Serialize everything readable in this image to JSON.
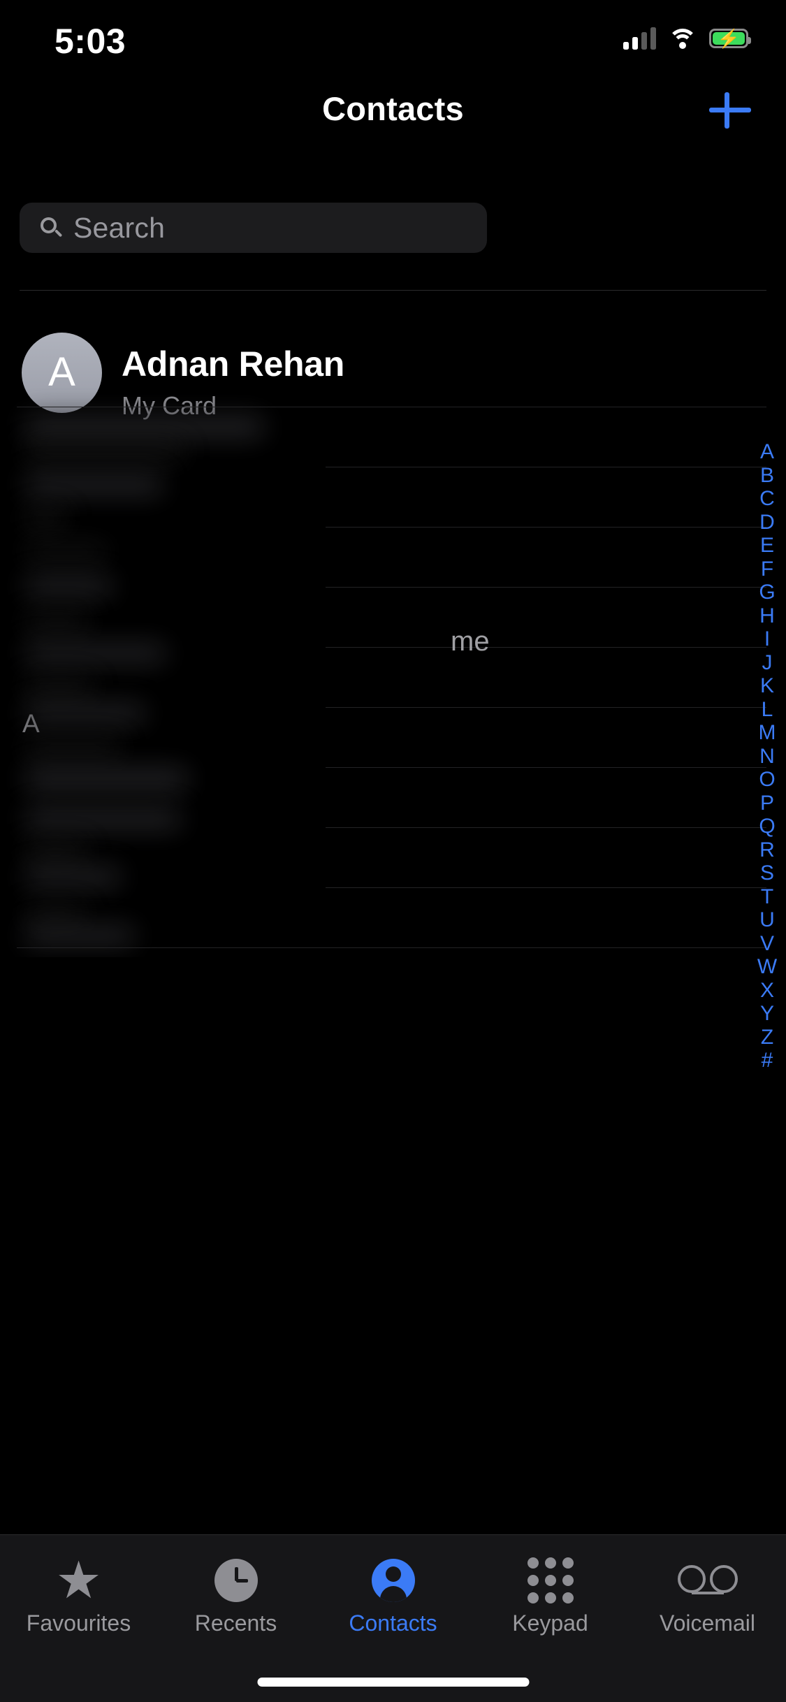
{
  "status_bar": {
    "time": "5:03",
    "signal_icon": "cellular-signal-icon",
    "wifi_icon": "wifi-icon",
    "battery_icon": "battery-charging-icon",
    "battery_charging": true,
    "battery_color": "#3ddc5c"
  },
  "nav": {
    "title": "Contacts",
    "add_button_icon": "plus-icon",
    "accent_color": "#3b7bf6"
  },
  "search": {
    "placeholder": "Search",
    "value": "",
    "icon": "search-icon"
  },
  "my_card": {
    "initial": "A",
    "name": "Adnan Rehan",
    "subtitle": "My Card"
  },
  "list": {
    "section_header": "A",
    "me_label": "me",
    "redacted": true,
    "rows": [
      {
        "redacted": true,
        "badge": ""
      },
      {
        "redacted": true,
        "badge": ""
      },
      {
        "redacted": true,
        "badge": ""
      },
      {
        "redacted": true,
        "badge": ""
      },
      {
        "redacted": true,
        "badge": "me"
      },
      {
        "redacted": true,
        "badge": ""
      },
      {
        "redacted": true,
        "badge": ""
      },
      {
        "redacted": true,
        "badge": ""
      },
      {
        "redacted": true,
        "badge": ""
      }
    ]
  },
  "alpha_index": {
    "letters": [
      "A",
      "B",
      "C",
      "D",
      "E",
      "F",
      "G",
      "H",
      "I",
      "J",
      "K",
      "L",
      "M",
      "N",
      "O",
      "P",
      "Q",
      "R",
      "S",
      "T",
      "U",
      "V",
      "W",
      "X",
      "Y",
      "Z",
      "#"
    ],
    "color": "#3b7bf6"
  },
  "tab_bar": {
    "active": "Contacts",
    "items": [
      {
        "label": "Favourites",
        "icon": "star-icon"
      },
      {
        "label": "Recents",
        "icon": "clock-icon"
      },
      {
        "label": "Contacts",
        "icon": "person-icon"
      },
      {
        "label": "Keypad",
        "icon": "keypad-icon"
      },
      {
        "label": "Voicemail",
        "icon": "voicemail-icon"
      }
    ],
    "active_color": "#3b7bf6",
    "inactive_color": "#9a9a9e"
  }
}
